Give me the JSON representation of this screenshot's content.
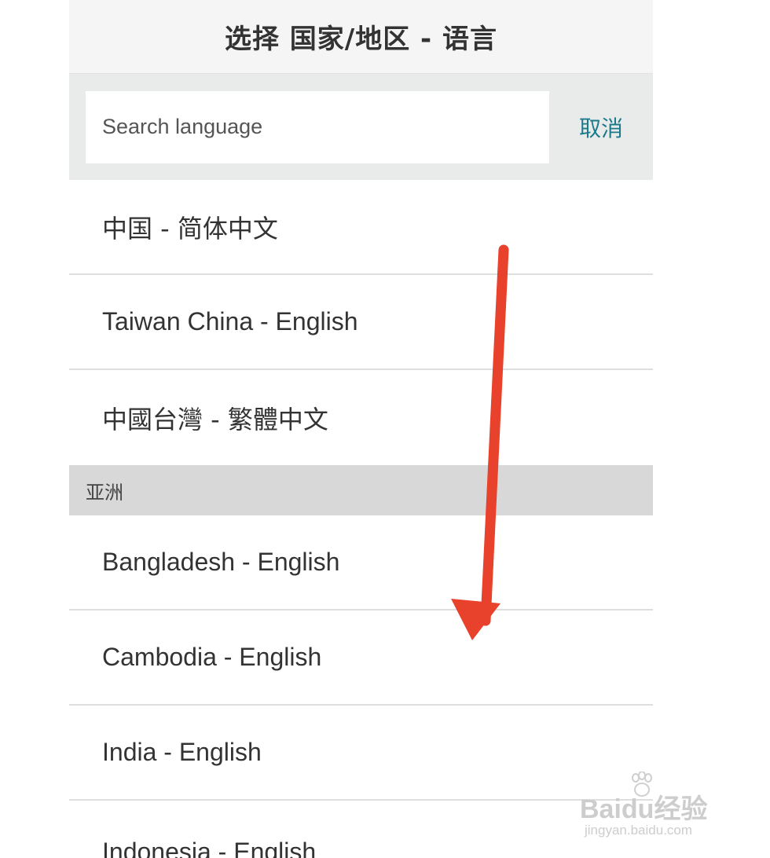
{
  "header": {
    "title": "选择 国家/地区 - 语言"
  },
  "search": {
    "placeholder": "Search language",
    "cancel_label": "取消"
  },
  "top_items": [
    {
      "label": "中国 - 简体中文"
    },
    {
      "label": "Taiwan China - English"
    },
    {
      "label": "中國台灣 - 繁體中文"
    }
  ],
  "asia_section": {
    "header": "亚洲",
    "items": [
      {
        "label": "Bangladesh - English"
      },
      {
        "label": "Cambodia - English"
      },
      {
        "label": "India - English"
      },
      {
        "label": "Indonesia - English"
      }
    ]
  },
  "annotation": {
    "arrow_color": "#e8412c",
    "arrow_icon": "red-arrow-down-icon"
  },
  "watermark": {
    "brand": "Baidu经验",
    "url": "jingyan.baidu.com"
  }
}
